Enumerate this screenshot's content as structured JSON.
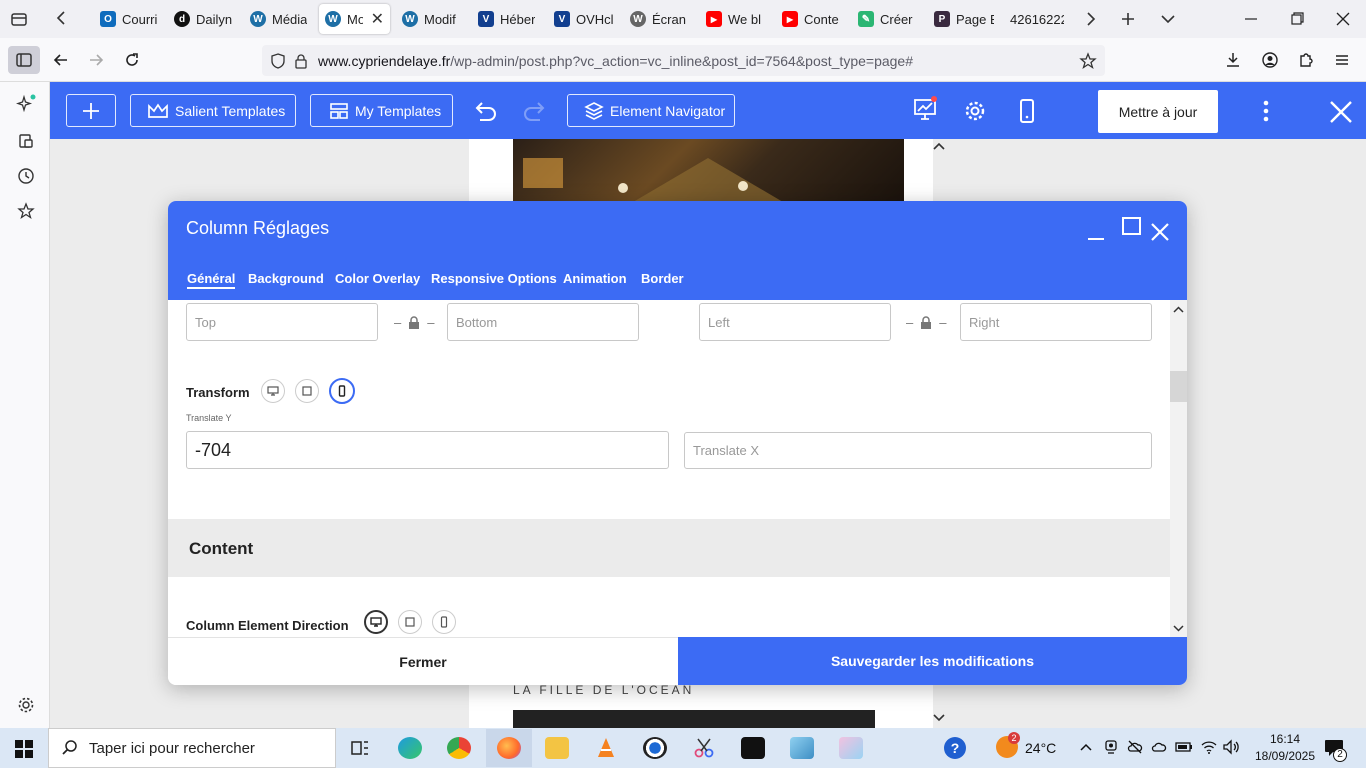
{
  "browser": {
    "tabs": [
      {
        "label": "Courri",
        "icon": "outlook-icon",
        "color": "#0f6cbd",
        "glyph": "O"
      },
      {
        "label": "Dailyn",
        "icon": "dailymotion-icon",
        "color": "#111111",
        "glyph": "d"
      },
      {
        "label": "Média",
        "icon": "wordpress-icon",
        "color": "#1e6fa6",
        "glyph": "W"
      },
      {
        "label": "Mo",
        "icon": "wordpress-icon",
        "color": "#1e6fa6",
        "glyph": "W",
        "active": true
      },
      {
        "label": "Modif",
        "icon": "wordpress-icon",
        "color": "#1e6fa6",
        "glyph": "W"
      },
      {
        "label": "Héber",
        "icon": "ovh-icon",
        "color": "#123f8f",
        "glyph": "V"
      },
      {
        "label": "OVHcl",
        "icon": "ovh-icon",
        "color": "#123f8f",
        "glyph": "V"
      },
      {
        "label": "Écran",
        "icon": "wordpress-icon",
        "color": "#555555",
        "glyph": "W"
      },
      {
        "label": "We bl",
        "icon": "youtube-icon",
        "color": "#ff0000",
        "glyph": "▶"
      },
      {
        "label": "Conte",
        "icon": "youtube-icon",
        "color": "#ff0000",
        "glyph": "▶"
      },
      {
        "label": "Créer",
        "icon": "pen-icon",
        "color": "#2bb673",
        "glyph": "✎"
      },
      {
        "label": "Page E",
        "icon": "page-icon",
        "color": "#3a2a3f",
        "glyph": "P"
      },
      {
        "label": "42616222",
        "icon": "none",
        "color": "#f0f0f4",
        "glyph": ""
      }
    ],
    "url_domain": "www.cypriendelaye.fr",
    "url_path": "/wp-admin/post.php?vc_action=vc_inline&post_id=7564&post_type=page#"
  },
  "builder": {
    "salient_templates": "Salient Templates",
    "my_templates": "My Templates",
    "element_navigator": "Element Navigator",
    "update": "Mettre à jour"
  },
  "page": {
    "caption": "LA FILLE DE L'OCEAN"
  },
  "modal": {
    "title": "Column Réglages",
    "tabs": [
      "Général",
      "Background",
      "Color Overlay",
      "Responsive Options",
      "Animation",
      "Border"
    ],
    "padding": {
      "top_placeholder": "Top",
      "bottom_placeholder": "Bottom",
      "left_placeholder": "Left",
      "right_placeholder": "Right",
      "separator": "–"
    },
    "transform_label": "Transform",
    "translate_y_label": "Translate Y",
    "translate_y_value": "-704",
    "translate_x_placeholder": "Translate X",
    "content_heading": "Content",
    "column_direction_label": "Column Element Direction",
    "close_button": "Fermer",
    "save_button": "Sauvegarder les modifications"
  },
  "taskbar": {
    "search_placeholder": "Taper ici pour rechercher",
    "weather_temp": "24°C",
    "weather_badge": "2",
    "time": "16:14",
    "date": "18/09/2025",
    "notification_count": "2"
  },
  "colors": {
    "accent": "#3c6bf4"
  }
}
